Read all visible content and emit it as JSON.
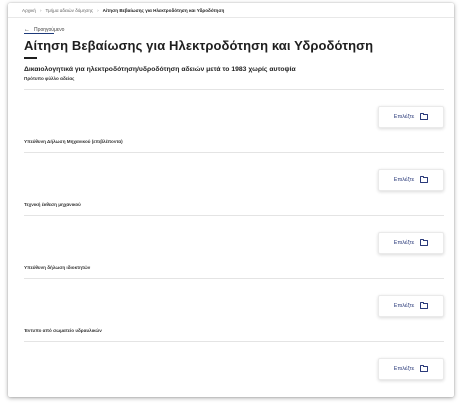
{
  "breadcrumb": {
    "home": "Αρχική",
    "section": "Τμήμα αδειών δόμησης",
    "current": "Αίτηση Βεβαίωσης για Ηλεκτροδότηση και Υδροδότηση"
  },
  "back_label": "Προηγούμενο",
  "page_title": "Αίτηση Βεβαίωσης για Ηλεκτροδότηση και Υδροδότηση",
  "subtitle": "Δικαιολογητικά για ηλεκτροδότηση/υδροδότηση αδειών μετά το 1983 χωρίς αυτοψία",
  "documents": [
    {
      "label": "Πρότυπο φύλλο αδείας",
      "button": "Επιλέξτε"
    },
    {
      "label": "Υπεύθυνη Δήλωση Μηχανικού (επιβλέποντα)",
      "button": "Επιλέξτε"
    },
    {
      "label": "Τεχνική έκθεση μηχανικού",
      "button": "Επιλέξτε"
    },
    {
      "label": "Υπεύθυνη δήλωση ιδιοκτητών",
      "button": "Επιλέξτε"
    },
    {
      "label": "Έντυπο από σωματείο υδραυλικών",
      "button": "Επιλέξτε"
    }
  ],
  "icons": {
    "back": "arrow-left-icon",
    "breadcrumb_separator": "chevron-right-icon",
    "upload": "folder-icon"
  },
  "colors": {
    "accent": "#2a3a7a",
    "title": "#1e1e1e"
  }
}
